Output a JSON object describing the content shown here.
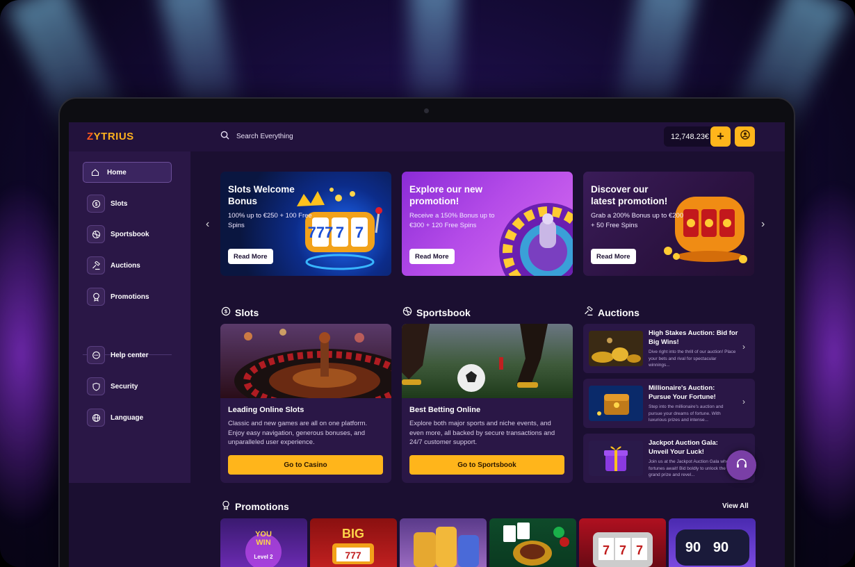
{
  "app": {
    "logo_first": "Z",
    "logo_rest": "YTRIUS",
    "accent": "#ffb51b",
    "brand": "#ff5a1e"
  },
  "search": {
    "placeholder": "Search Everything",
    "icon": "search-icon"
  },
  "wallet": {
    "balance": "12,748.23€",
    "add_icon": "plus-icon",
    "user_icon": "user-icon"
  },
  "sidebar": {
    "items": [
      {
        "label": "Home",
        "icon": "home-icon",
        "active": true
      },
      {
        "label": "Slots",
        "icon": "coin-icon"
      },
      {
        "label": "Sportsbook",
        "icon": "ball-icon"
      },
      {
        "label": "Auctions",
        "icon": "gavel-icon"
      },
      {
        "label": "Promotions",
        "icon": "award-icon"
      }
    ],
    "support_items": [
      {
        "label": "Help center",
        "icon": "chat-icon"
      },
      {
        "label": "Security",
        "icon": "shield-icon"
      },
      {
        "label": "Language",
        "icon": "globe-icon"
      }
    ]
  },
  "banners": [
    {
      "title": "Slots Welcome Bonus",
      "text": "100% up to €250 + 100 Free Spins",
      "button": "Read More"
    },
    {
      "title": "Explore our new promotion!",
      "text": "Receive a 150% Bonus up to €300 + 120 Free Spins",
      "button": "Read More"
    },
    {
      "title": "Discover our latest promotion!",
      "text": "Grab a 200% Bonus up to €200 + 50 Free Spins",
      "button": "Read More"
    }
  ],
  "sections": {
    "slots": {
      "title": "Slots",
      "card_title": "Leading Online Slots",
      "card_text": "Classic and new games are all on one platform. Enjoy easy navigation, generous bonuses, and unparalleled user experience.",
      "button": "Go to Casino"
    },
    "sportsbook": {
      "title": "Sportsbook",
      "card_title": "Best Betting Online",
      "card_text": "Explore both major sports and niche events, and even more, all backed by secure transactions and 24/7 customer support.",
      "button": "Go to Sportsbook"
    },
    "auctions": {
      "title": "Auctions",
      "items": [
        {
          "title": "High Stakes Auction: Bid for Big Wins!",
          "text": "Dive right into the thrill of our auction! Place your bets and rival for spectacular winnings..."
        },
        {
          "title": "Millionaire's Auction: Pursue Your Fortune!",
          "text": "Step into the millionaire's auction and pursue your dreams of fortune. With luxurious prizes and intense..."
        },
        {
          "title": "Jackpot Auction Gala: Unveil Your Luck!",
          "text": "Join us at the Jackpot Auction Gala where fortunes await! Bid boldly to unlock the grand prize and revel..."
        }
      ]
    }
  },
  "promotions": {
    "title": "Promotions",
    "view_all": "View All",
    "tiles": [
      "You Win Level 2",
      "Big 777",
      "Coin stacks",
      "Casino chips",
      "777 slots",
      "90 90 X"
    ],
    "tile_text": {
      "win": "YOU",
      "win2": "WIN",
      "level": "Level 2",
      "big": "BIG",
      "sevens": "777",
      "ninety": "90"
    }
  }
}
